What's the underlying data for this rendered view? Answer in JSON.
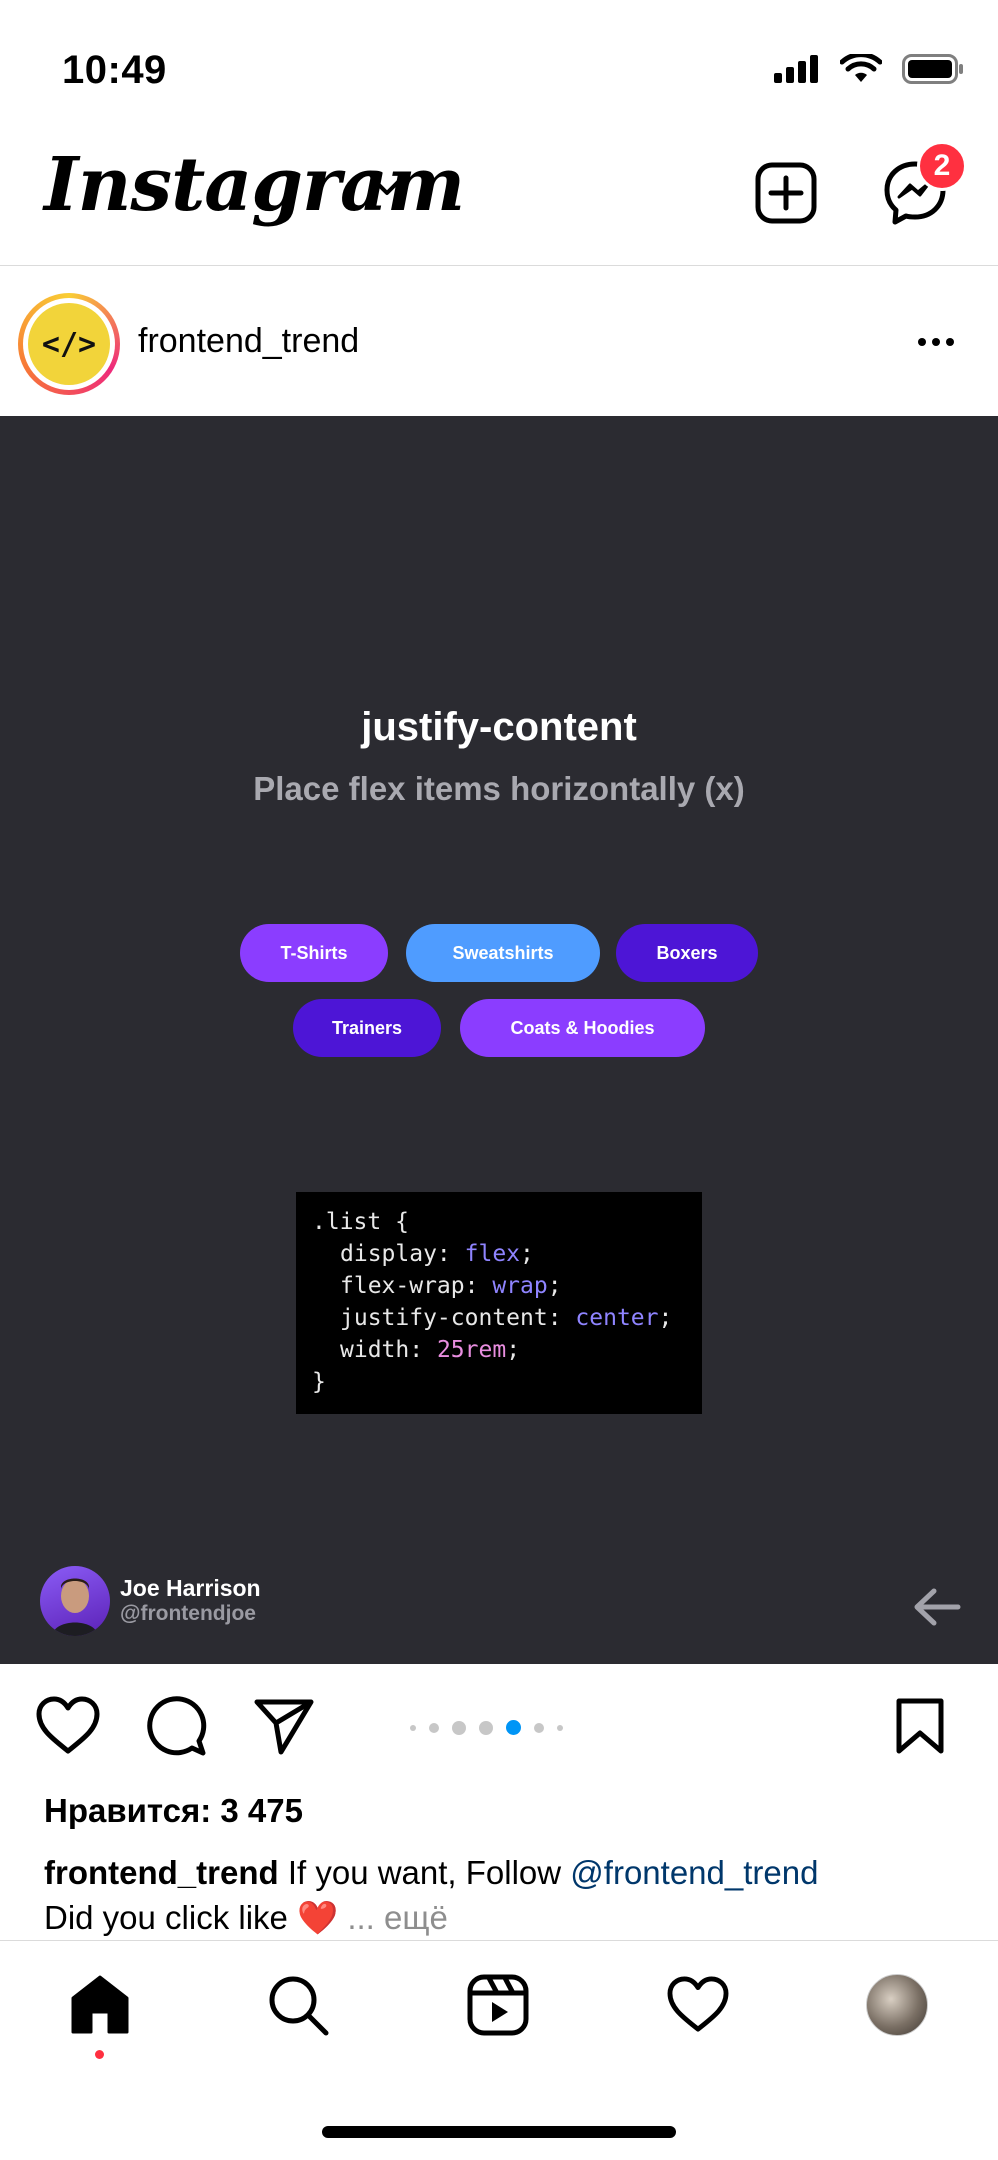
{
  "status_bar": {
    "time": "10:49",
    "icons": [
      "signal-icon",
      "wifi-icon",
      "battery-icon"
    ]
  },
  "header": {
    "logo": "Instagram",
    "icons": [
      "chevron-down-icon",
      "new-post-icon",
      "messenger-icon"
    ],
    "messages_badge": "2"
  },
  "post": {
    "username": "frontend_trend",
    "avatar_text": "</>",
    "media": {
      "title": "justify-content",
      "subtitle": "Place flex items horizontally (x)",
      "pills": [
        "T-Shirts",
        "Sweatshirts",
        "Boxers",
        "Trainers",
        "Coats & Hoodies"
      ],
      "code": {
        "l1": ".list {",
        "l2_prop": "display: ",
        "l2_val": "flex",
        "l2_end": ";",
        "l3_prop": "flex-wrap: ",
        "l3_val": "wrap",
        "l3_end": ";",
        "l4_prop": "justify-content: ",
        "l4_val": "center",
        "l4_end": ";",
        "l5_prop": "width: ",
        "l5_val": "25rem",
        "l5_end": ";",
        "l6": "}"
      },
      "author_name": "Joe Harrison",
      "author_handle": "@frontendjoe"
    },
    "carousel": {
      "total": 7,
      "active": 4
    },
    "likes": "Нравится: 3 475",
    "caption": {
      "user": "frontend_trend",
      "text": " If you want, Follow ",
      "mention": "@frontend_trend",
      "line2": "Did you click like ",
      "emoji": "❤️",
      "more": " ... ещё"
    }
  },
  "colors": {
    "accent_blue": "#0095f6",
    "badge_red": "#ff3040",
    "media_bg": "#2b2b31",
    "pill_purple": "#8b3dff",
    "pill_blue": "#4f9cff",
    "pill_dark_purple": "#4d15d6"
  },
  "bottom_nav": [
    "home-icon",
    "search-icon",
    "reels-icon",
    "activity-icon",
    "profile-avatar"
  ]
}
